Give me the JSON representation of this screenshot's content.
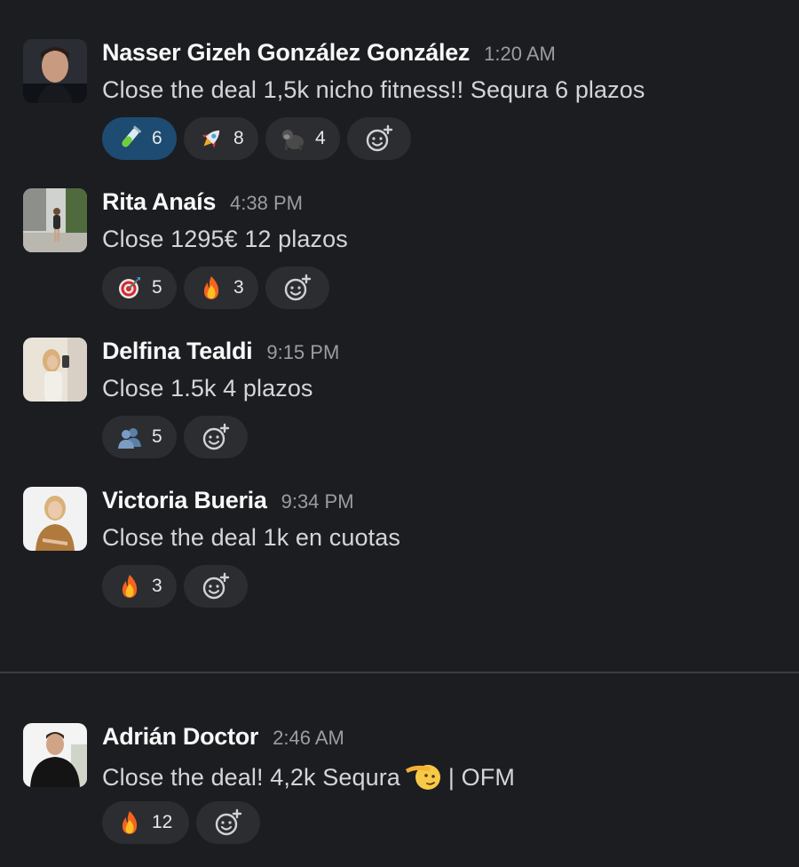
{
  "messages": [
    {
      "author": "Nasser Gizeh González González",
      "time": "1:20 AM",
      "text": "Close the deal 1,5k nicho fitness!! Sequra 6 plazos",
      "reactions": [
        {
          "emoji": "test-tube",
          "count": "6",
          "mine": true
        },
        {
          "emoji": "rocket",
          "count": "8"
        },
        {
          "emoji": "gorilla",
          "count": "4"
        }
      ]
    },
    {
      "author": "Rita Anaís",
      "time": "4:38 PM",
      "text": "Close 1295€ 12 plazos",
      "reactions": [
        {
          "emoji": "direct-hit",
          "count": "5"
        },
        {
          "emoji": "fire",
          "count": "3"
        }
      ]
    },
    {
      "author": "Delfina Tealdi",
      "time": "9:15 PM",
      "text": "Close 1.5k 4 plazos",
      "reactions": [
        {
          "emoji": "busts-in-silhouette",
          "count": "5"
        }
      ]
    },
    {
      "author": "Victoria Bueria",
      "time": "9:34 PM",
      "text": "Close the deal 1k en cuotas",
      "reactions": [
        {
          "emoji": "fire",
          "count": "3"
        }
      ]
    },
    {
      "author": "Adrián Doctor",
      "time": "2:46 AM",
      "text_before": "Close the deal! 4,2k Sequra",
      "text_emoji": "saluting-face",
      "text_after": "| OFM",
      "reactions": [
        {
          "emoji": "fire",
          "count": "12"
        }
      ]
    }
  ],
  "colors": {
    "background": "#1b1d21",
    "reaction_bg": "#2b2d31",
    "reaction_mine_bg": "#1d4b72",
    "author": "#f8f8f8",
    "timestamp": "#9c9d9f"
  }
}
